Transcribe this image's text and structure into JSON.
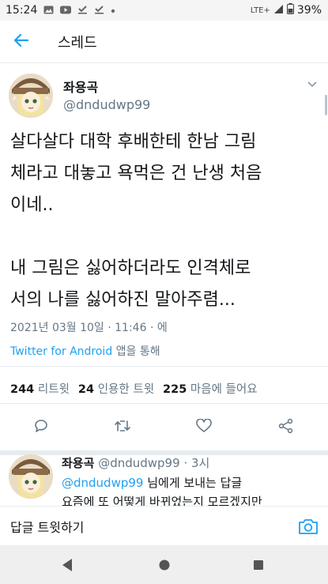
{
  "status_bar": {
    "time": "15:24",
    "network": "LTE+",
    "battery": "39%"
  },
  "header": {
    "title": "스레드"
  },
  "tweet": {
    "author_name": "좌용곡",
    "author_handle": "@dndudwp99",
    "text": "살다살다 대학 후배한테 한남 그림\n체라고 대놓고 욕먹은 건 난생 처음\n이네..\n\n내 그림은 싫어하더라도 인격체로\n서의 나를 싫어하진 말아주렴...",
    "date": "2021년 03월 10일 · 11:46 · 에",
    "source_app": "Twitter for Android",
    "source_suffix": " 앱을 통해",
    "retweets_count": "244",
    "retweets_label": "리트윗",
    "quotes_count": "24",
    "quotes_label": "인용한 트윗",
    "likes_count": "225",
    "likes_label": "마음에 들어요"
  },
  "reply": {
    "author_name": "좌용곡",
    "author_handle": "@dndudwp99",
    "time": "· 3시",
    "mention": "@dndudwp99",
    "mention_suffix": " 님에게 보내는 답글",
    "text_preview": "요즘에 또 어떻게 바뀌었는지 모르겠지만"
  },
  "compose": {
    "placeholder": "답글 트윗하기"
  },
  "colors": {
    "accent": "#1da1f2",
    "secondary_text": "#657786",
    "divider": "#e6ecf0"
  }
}
